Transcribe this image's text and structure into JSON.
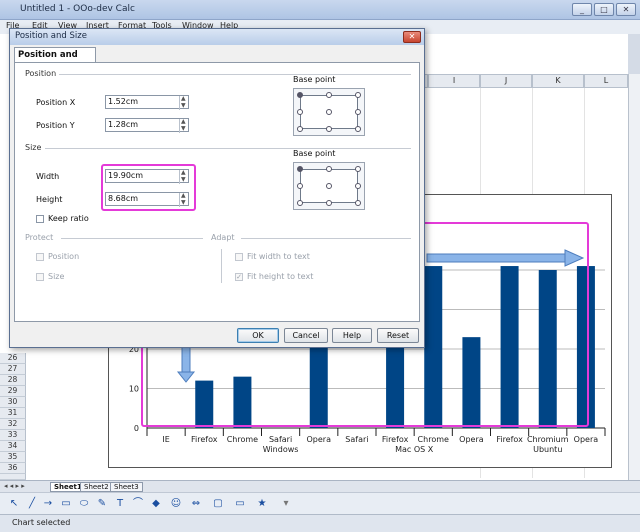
{
  "window": {
    "title": "Untitled 1 - OOo-dev Calc",
    "controls": [
      "_",
      "□",
      "✕"
    ]
  },
  "menu": [
    "File",
    "Edit",
    "View",
    "Insert",
    "Format",
    "Tools",
    "Window",
    "Help"
  ],
  "columns": [
    "I",
    "J",
    "K",
    "L"
  ],
  "rows": [
    "26",
    "27",
    "28",
    "29",
    "30",
    "31",
    "32",
    "33",
    "34",
    "35",
    "36",
    "37"
  ],
  "sheet_tabs": [
    "Sheet1",
    "Sheet2",
    "Sheet3"
  ],
  "status": {
    "text": "Chart selected"
  },
  "dialog": {
    "title": "Position and Size",
    "tab": "Position and Size",
    "position": {
      "section": "Position",
      "x_label": "Position X",
      "x_value": "1.52cm",
      "y_label": "Position Y",
      "y_value": "1.28cm",
      "base_point_label": "Base point"
    },
    "size": {
      "section": "Size",
      "width_label": "Width",
      "width_value": "19.90cm",
      "height_label": "Height",
      "height_value": "8.68cm",
      "keep_ratio": "Keep ratio",
      "base_point_label": "Base point"
    },
    "protect": {
      "section": "Protect",
      "position": "Position",
      "size": "Size"
    },
    "adapt": {
      "section": "Adapt",
      "fit_width": "Fit width to text",
      "fit_height": "Fit height to text"
    },
    "buttons": {
      "ok": "OK",
      "cancel": "Cancel",
      "help": "Help",
      "reset": "Reset"
    }
  },
  "colors": {
    "bar": "#004586",
    "highlight": "#e43ad8",
    "arrow": "#8ab4e8"
  },
  "chart_data": {
    "type": "bar",
    "categories": [
      "IE",
      "Firefox",
      "Chrome",
      "Safari",
      "Opera",
      "Safari",
      "Firefox",
      "Chrome",
      "Opera",
      "Firefox",
      "Chromium",
      "Opera"
    ],
    "groups": [
      {
        "name": "Windows",
        "span": [
          2,
          4
        ]
      },
      {
        "name": "Mac OS X",
        "span": [
          5,
          8
        ]
      },
      {
        "name": "Ubuntu",
        "span": [
          9,
          11
        ]
      }
    ],
    "values": [
      null,
      12,
      13,
      null,
      23,
      null,
      23,
      41,
      23,
      41,
      40,
      41
    ],
    "ylim": [
      0,
      40
    ],
    "yticks": [
      "0",
      "10",
      "20"
    ]
  }
}
